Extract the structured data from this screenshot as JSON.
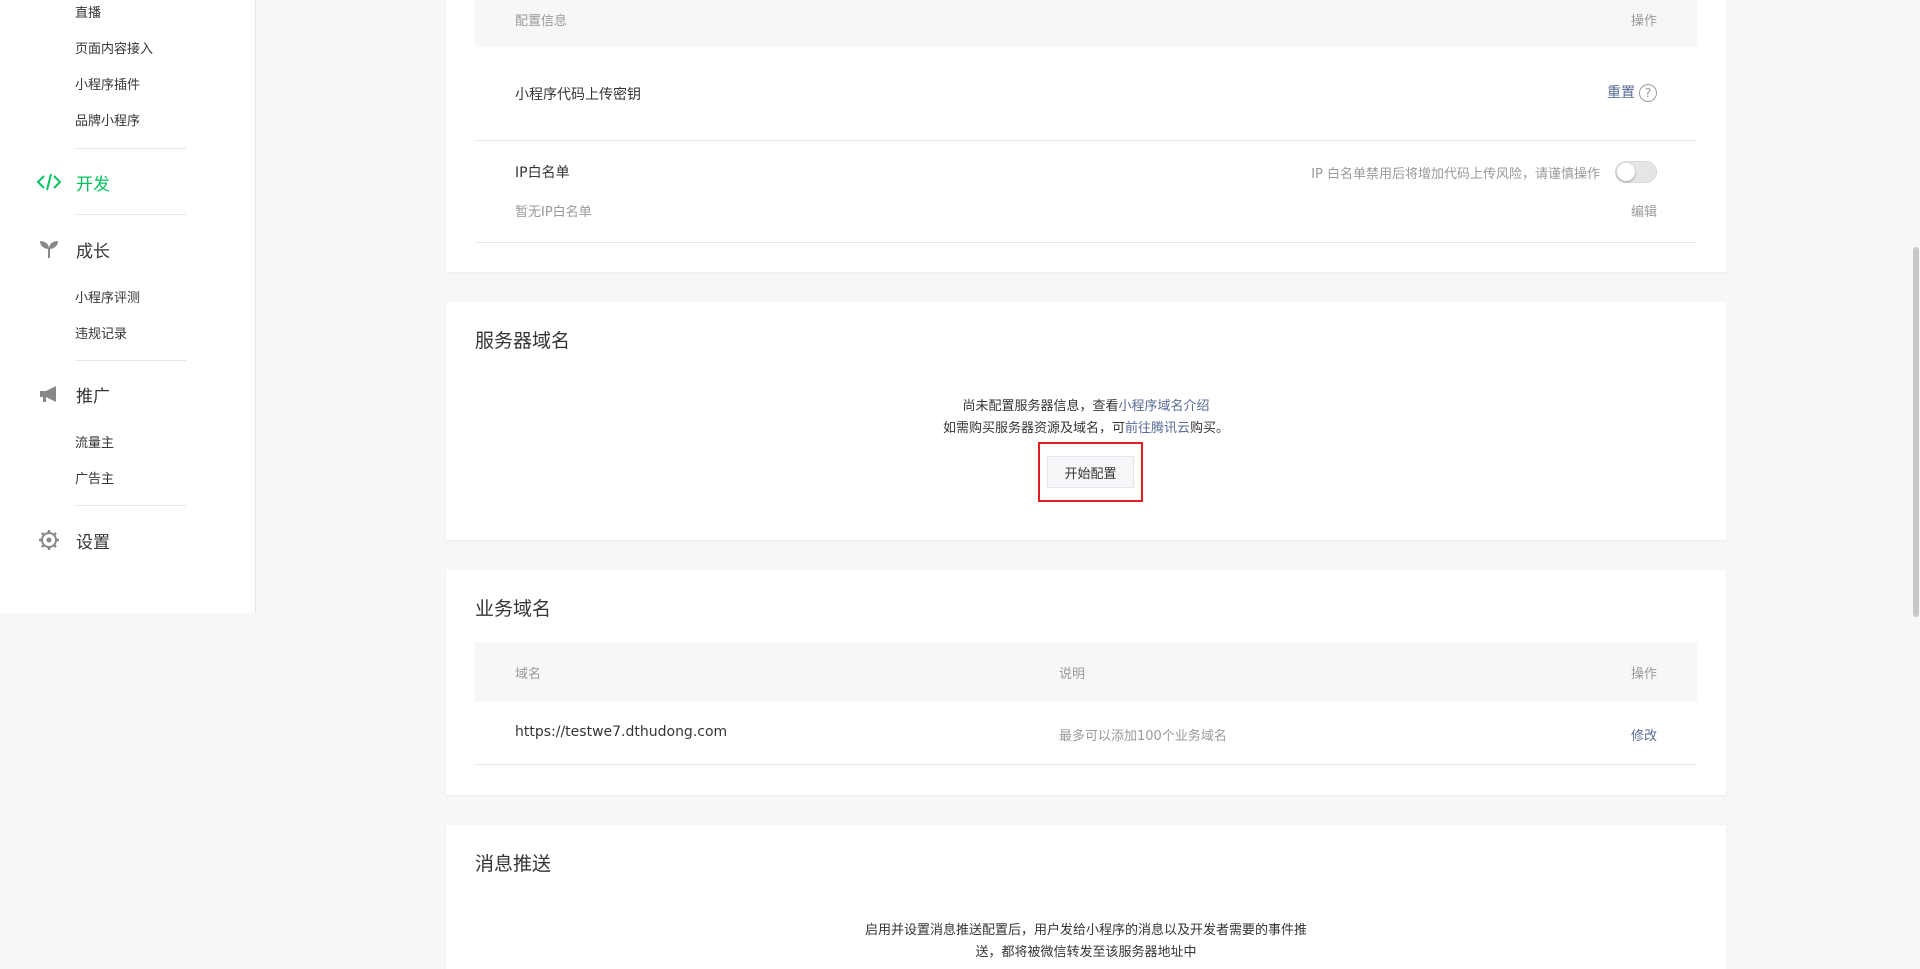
{
  "sidebar": {
    "sub_items_top": [
      "直播",
      "页面内容接入",
      "小程序插件",
      "品牌小程序"
    ],
    "dev": "开发",
    "growth": "成长",
    "growth_items": [
      "小程序评测",
      "违规记录"
    ],
    "promo": "推广",
    "promo_items": [
      "流量主",
      "广告主"
    ],
    "settings": "设置",
    "active_color": "#07c160"
  },
  "config_card": {
    "head_left": "配置信息",
    "head_right": "操作",
    "upload_key_label": "小程序代码上传密钥",
    "reset_link": "重置",
    "help_glyph": "?",
    "ip_label": "IP白名单",
    "ip_warning": "IP 白名单禁用后将增加代码上传风险，请谨慎操作",
    "ip_toggle_on": false,
    "ip_empty": "暂无IP白名单",
    "edit": "编辑"
  },
  "server_card": {
    "title": "服务器域名",
    "line1_prefix": "尚未配置服务器信息，查看",
    "line1_link": "小程序域名介绍",
    "line2_prefix": "如需购买服务器资源及域名，可",
    "line2_link": "前往腾讯云",
    "line2_suffix": "购买。",
    "start_button": "开始配置"
  },
  "business_card": {
    "title": "业务域名",
    "columns": [
      "域名",
      "说明",
      "操作"
    ],
    "rows": [
      {
        "domain": "https://testwe7.dthudong.com",
        "desc": "最多可以添加100个业务域名",
        "action": "修改"
      }
    ]
  },
  "push_card": {
    "title": "消息推送",
    "desc_line1": "启用并设置消息推送配置后，用户发给小程序的消息以及开发者需要的事件推",
    "desc_line2": "送，都将被微信转发至该服务器地址中"
  },
  "colors": {
    "link": "#576b95",
    "highlight_box": "#e02020"
  }
}
